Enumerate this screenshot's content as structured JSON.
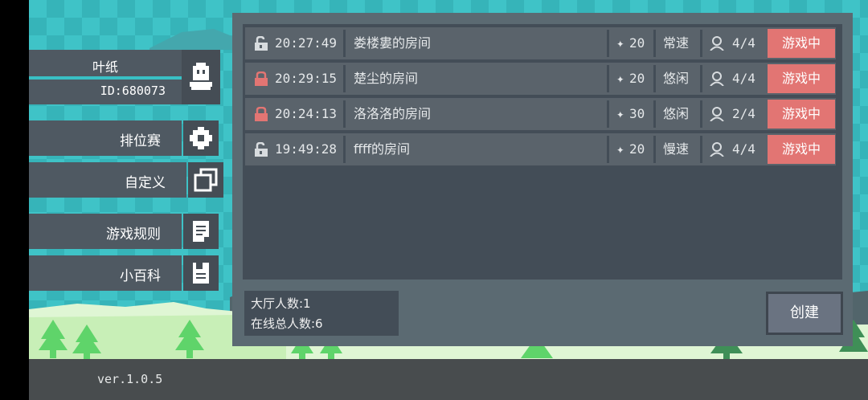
{
  "profile": {
    "name": "叶纸",
    "id": "ID:680073",
    "icon": "ghost-avatar-icon"
  },
  "menu": [
    {
      "label": "排位赛",
      "icon": "gear-icon"
    },
    {
      "label": "自定义",
      "icon": "copy-windows-icon"
    },
    {
      "label": "游戏规则",
      "icon": "document-icon"
    },
    {
      "label": "小百科",
      "icon": "notebook-icon"
    }
  ],
  "rooms": [
    {
      "lock": "unlocked",
      "time": "20:27:49",
      "name": "娄楼婁的房间",
      "score": "20",
      "speed": "常速",
      "players": "4/4",
      "status": "游戏中"
    },
    {
      "lock": "locked",
      "time": "20:29:15",
      "name": "楚尘的房间",
      "score": "20",
      "speed": "悠闲",
      "players": "4/4",
      "status": "游戏中"
    },
    {
      "lock": "locked",
      "time": "20:24:13",
      "name": "洛洛洛的房间",
      "score": "30",
      "speed": "悠闲",
      "players": "2/4",
      "status": "游戏中"
    },
    {
      "lock": "unlocked",
      "time": "19:49:28",
      "name": "ffff的房间",
      "score": "20",
      "speed": "慢速",
      "players": "4/4",
      "status": "游戏中"
    }
  ],
  "stats": {
    "lobby": "大厅人数:1",
    "online": "在线总人数:6"
  },
  "create_label": "创建",
  "version": "ver.1.0.5",
  "colors": {
    "lock_closed": "#e27573",
    "lock_open": "#d8dcdf",
    "status_bg": "#e27573",
    "sky": "#3fc3c7",
    "tree": "#5fd46a"
  }
}
